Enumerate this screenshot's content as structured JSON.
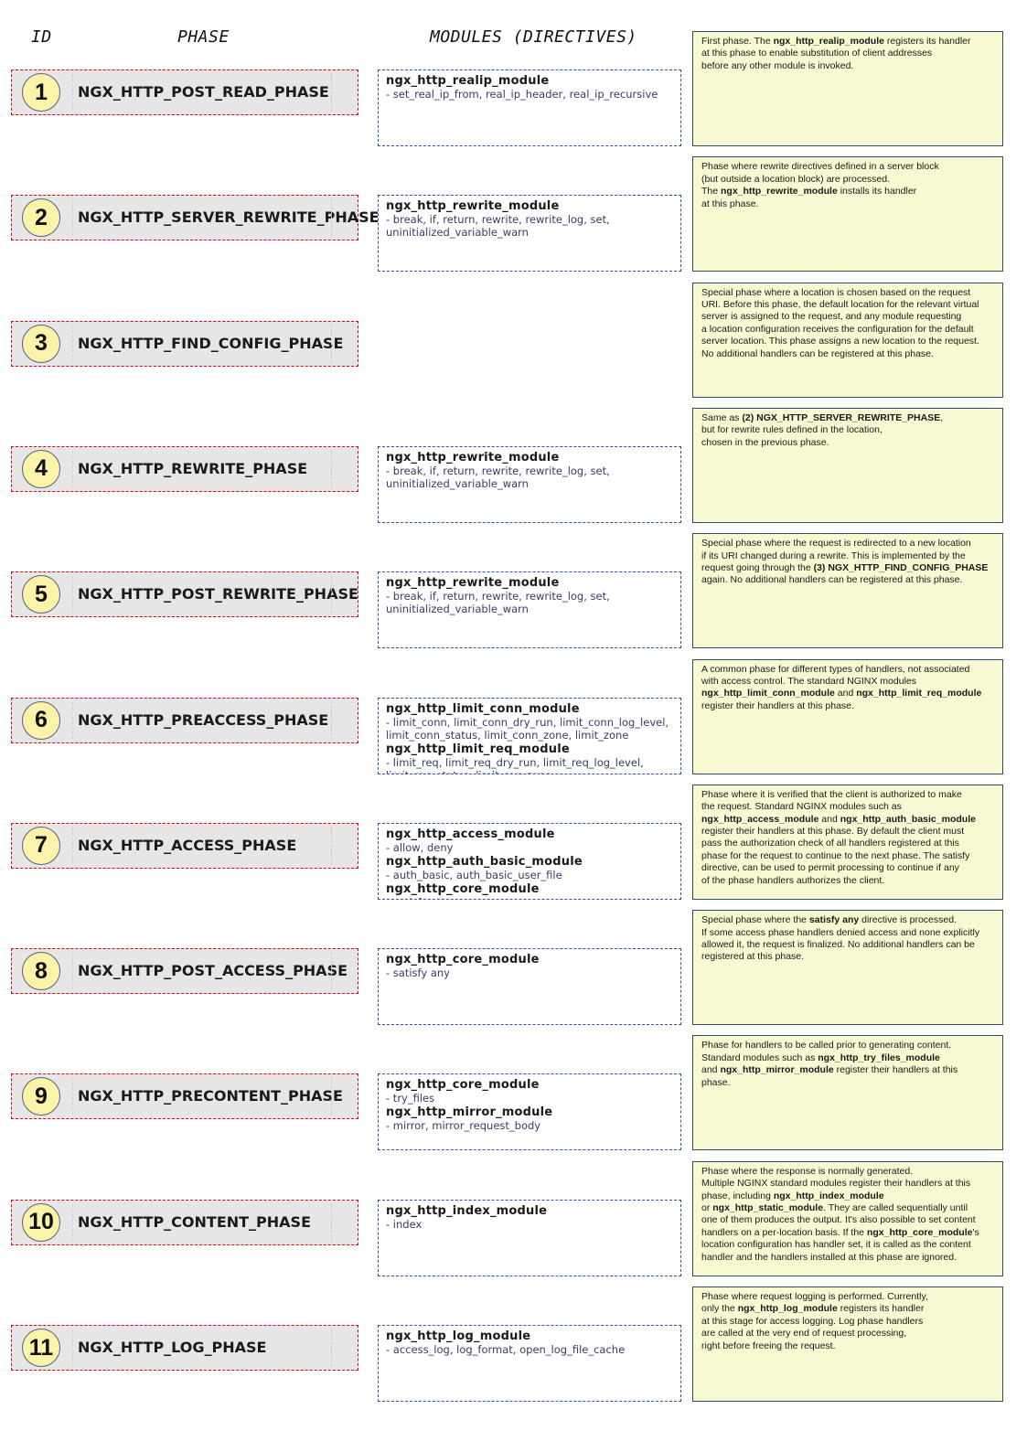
{
  "headers": {
    "id": "ID",
    "phase": "PHASE",
    "modules": "MODULES (DIRECTIVES)"
  },
  "phases": [
    {
      "id": "1",
      "name": "NGX_HTTP_POST_READ_PHASE",
      "modules": [
        {
          "name": "ngx_http_realip_module",
          "directives": "- set_real_ip_from, real_ip_header, real_ip_recursive"
        }
      ],
      "description": [
        {
          "t": "First phase. The "
        },
        {
          "t": "ngx_http_realip_module",
          "b": true
        },
        {
          "t": " registers its handler"
        },
        {
          "br": true
        },
        {
          "t": "at this phase to enable substitution of client addresses"
        },
        {
          "br": true
        },
        {
          "t": "before any other module is invoked."
        }
      ]
    },
    {
      "id": "2",
      "name": "NGX_HTTP_SERVER_REWRITE_PHASE",
      "modules": [
        {
          "name": "ngx_http_rewrite_module",
          "directives": "- break, if, return, rewrite, rewrite_log, set, uninitialized_variable_warn"
        }
      ],
      "description": [
        {
          "t": "Phase where rewrite directives defined in a server block"
        },
        {
          "br": true
        },
        {
          "t": "(but outside a location block) are processed."
        },
        {
          "br": true
        },
        {
          "t": "The "
        },
        {
          "t": "ngx_http_rewrite_module",
          "b": true
        },
        {
          "t": " installs its handler"
        },
        {
          "br": true
        },
        {
          "t": "at this phase."
        }
      ]
    },
    {
      "id": "3",
      "name": "NGX_HTTP_FIND_CONFIG_PHASE",
      "modules": [],
      "description": [
        {
          "t": "Special phase where a location is chosen based on the request"
        },
        {
          "br": true
        },
        {
          "t": "URI. Before this phase, the default location for the relevant virtual"
        },
        {
          "br": true
        },
        {
          "t": "server is assigned to the request, and any module requesting"
        },
        {
          "br": true
        },
        {
          "t": "a location configuration receives the configuration for the default"
        },
        {
          "br": true
        },
        {
          "t": "server location. This phase assigns a new location to the request."
        },
        {
          "br": true
        },
        {
          "t": "No additional handlers can be registered at this phase."
        }
      ]
    },
    {
      "id": "4",
      "name": "NGX_HTTP_REWRITE_PHASE",
      "modules": [
        {
          "name": "ngx_http_rewrite_module",
          "directives": "- break, if, return, rewrite, rewrite_log, set, uninitialized_variable_warn"
        }
      ],
      "description": [
        {
          "t": "Same as "
        },
        {
          "t": "(2) NGX_HTTP_SERVER_REWRITE_PHASE",
          "b": true
        },
        {
          "t": ","
        },
        {
          "br": true
        },
        {
          "t": "but for rewrite rules defined in the location,"
        },
        {
          "br": true
        },
        {
          "t": "chosen in the previous phase."
        }
      ]
    },
    {
      "id": "5",
      "name": "NGX_HTTP_POST_REWRITE_PHASE",
      "modules": [
        {
          "name": "ngx_http_rewrite_module",
          "directives": "- break, if, return, rewrite, rewrite_log, set, uninitialized_variable_warn"
        }
      ],
      "description": [
        {
          "t": "Special phase where the request is redirected to a new location"
        },
        {
          "br": true
        },
        {
          "t": "if its URI changed during a rewrite. This is implemented by the"
        },
        {
          "br": true
        },
        {
          "t": "request going through the "
        },
        {
          "t": "(3) NGX_HTTP_FIND_CONFIG_PHASE",
          "b": true
        },
        {
          "br": true
        },
        {
          "t": "again. No additional handlers can be registered at this phase."
        }
      ]
    },
    {
      "id": "6",
      "name": "NGX_HTTP_PREACCESS_PHASE",
      "modules": [
        {
          "name": "ngx_http_limit_conn_module",
          "directives": "- limit_conn, limit_conn_dry_run, limit_conn_log_level, limit_conn_status, limit_conn_zone, limit_zone"
        },
        {
          "name": "ngx_http_limit_req_module",
          "directives": "- limit_req, limit_req_dry_run, limit_req_log_level, limit_req_status, limit_req_zone"
        }
      ],
      "description": [
        {
          "t": "A common phase for different types of handlers, not associated"
        },
        {
          "br": true
        },
        {
          "t": "with access control. The standard NGINX modules"
        },
        {
          "br": true
        },
        {
          "t": "ngx_http_limit_conn_module",
          "b": true
        },
        {
          "t": " and "
        },
        {
          "t": "ngx_http_limit_req_module",
          "b": true
        },
        {
          "br": true
        },
        {
          "t": "register their handlers at this phase."
        }
      ]
    },
    {
      "id": "7",
      "name": "NGX_HTTP_ACCESS_PHASE",
      "modules": [
        {
          "name": "ngx_http_access_module",
          "directives": "- allow, deny"
        },
        {
          "name": "ngx_http_auth_basic_module",
          "directives": "- auth_basic, auth_basic_user_file"
        },
        {
          "name": "ngx_http_core_module",
          "directives": "- satisfy"
        }
      ],
      "description": [
        {
          "t": "Phase where it is verified that the client is authorized to make"
        },
        {
          "br": true
        },
        {
          "t": "the request. Standard NGINX modules such as"
        },
        {
          "br": true
        },
        {
          "t": "ngx_http_access_module",
          "b": true
        },
        {
          "t": " and "
        },
        {
          "t": "ngx_http_auth_basic_module",
          "b": true
        },
        {
          "br": true
        },
        {
          "t": "register their handlers at this phase. By default the client must"
        },
        {
          "br": true
        },
        {
          "t": "pass the authorization check of all handlers registered at this"
        },
        {
          "br": true
        },
        {
          "t": "phase for the request to continue to the next phase. The satisfy"
        },
        {
          "br": true
        },
        {
          "t": "directive, can be used to permit processing to continue if any"
        },
        {
          "br": true
        },
        {
          "t": "of the phase handlers authorizes the client."
        }
      ]
    },
    {
      "id": "8",
      "name": "NGX_HTTP_POST_ACCESS_PHASE",
      "modules": [
        {
          "name": "ngx_http_core_module",
          "directives": "- satisfy any"
        }
      ],
      "description": [
        {
          "t": "Special phase where the "
        },
        {
          "t": "satisfy any",
          "b": true
        },
        {
          "t": " directive is processed."
        },
        {
          "br": true
        },
        {
          "t": "If some access phase handlers denied access and none explicitly"
        },
        {
          "br": true
        },
        {
          "t": "allowed it, the request is finalized. No additional handlers can be"
        },
        {
          "br": true
        },
        {
          "t": "registered at this phase."
        }
      ]
    },
    {
      "id": "9",
      "name": "NGX_HTTP_PRECONTENT_PHASE",
      "modules": [
        {
          "name": "ngx_http_core_module",
          "directives": "- try_files"
        },
        {
          "name": "ngx_http_mirror_module",
          "directives": "- mirror, mirror_request_body"
        }
      ],
      "description": [
        {
          "t": "Phase for handlers to be called prior to generating content."
        },
        {
          "br": true
        },
        {
          "t": "Standard modules such as "
        },
        {
          "t": "ngx_http_try_files_module",
          "b": true
        },
        {
          "br": true
        },
        {
          "t": "and "
        },
        {
          "t": "ngx_http_mirror_module",
          "b": true
        },
        {
          "t": " register their handlers at this"
        },
        {
          "br": true
        },
        {
          "t": "phase."
        }
      ]
    },
    {
      "id": "10",
      "name": "NGX_HTTP_CONTENT_PHASE",
      "modules": [
        {
          "name": "ngx_http_index_module",
          "directives": "- index"
        }
      ],
      "description": [
        {
          "t": "Phase where the response is normally generated."
        },
        {
          "br": true
        },
        {
          "t": "Multiple NGINX standard modules register their handlers at this"
        },
        {
          "br": true
        },
        {
          "t": "phase, including "
        },
        {
          "t": "ngx_http_index_module",
          "b": true
        },
        {
          "br": true
        },
        {
          "t": "or "
        },
        {
          "t": "ngx_http_static_module",
          "b": true
        },
        {
          "t": ". They are called sequentially until"
        },
        {
          "br": true
        },
        {
          "t": "one of them produces the output. It's also possible to set content"
        },
        {
          "br": true
        },
        {
          "t": "handlers on a per-location basis. If the "
        },
        {
          "t": "ngx_http_core_module",
          "b": true
        },
        {
          "t": "'s"
        },
        {
          "br": true
        },
        {
          "t": "location configuration has handler set, it is called as the content"
        },
        {
          "br": true
        },
        {
          "t": "handler and the handlers installed at this phase are ignored."
        }
      ]
    },
    {
      "id": "11",
      "name": "NGX_HTTP_LOG_PHASE",
      "modules": [
        {
          "name": "ngx_http_log_module",
          "directives": "- access_log, log_format, open_log_file_cache"
        }
      ],
      "description": [
        {
          "t": "Phase where request logging is performed. Currently,"
        },
        {
          "br": true
        },
        {
          "t": "only the "
        },
        {
          "t": "ngx_http_log_module",
          "b": true
        },
        {
          "t": " registers its handler"
        },
        {
          "br": true
        },
        {
          "t": "at this stage for access logging. Log phase handlers"
        },
        {
          "br": true
        },
        {
          "t": "are called at the very end of request processing,"
        },
        {
          "br": true
        },
        {
          "t": "right before freeing the request."
        }
      ]
    }
  ]
}
